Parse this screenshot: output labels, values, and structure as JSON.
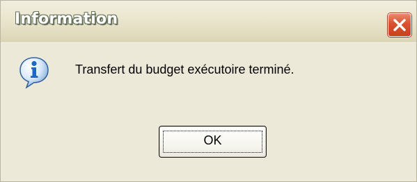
{
  "window": {
    "title": "Information",
    "close_icon": "close-icon"
  },
  "content": {
    "icon": "info-icon",
    "message": "Transfert du budget exécutoire terminé."
  },
  "buttons": {
    "ok_label": "OK"
  },
  "colors": {
    "dialog_background": "#ECE9D8",
    "close_button": "#D9512D",
    "info_icon_blue": "#2E7FD6"
  }
}
